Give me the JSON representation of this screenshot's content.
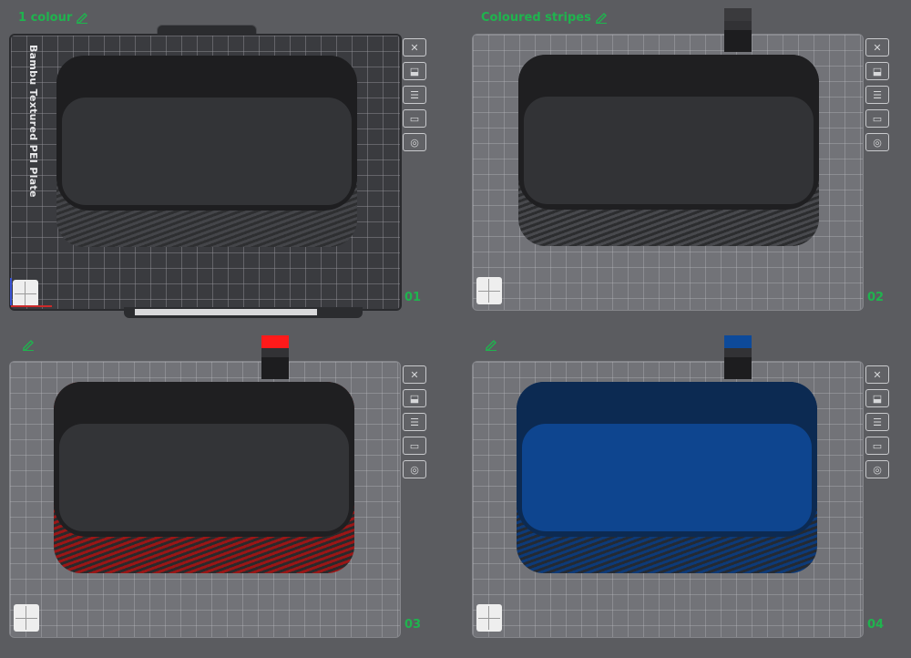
{
  "plates": [
    {
      "title": "1 colour",
      "number": "01",
      "label": "Bambu Textured PEI Plate",
      "style": "dark",
      "tray": {
        "top": "#1e1e20",
        "floor": "#333437",
        "wall_a": "#2e2f31",
        "wall_b": "#444549"
      },
      "tower": null
    },
    {
      "title": "Coloured stripes",
      "number": "02",
      "style": "light",
      "tray": {
        "top": "#1f1f21",
        "floor": "#323336",
        "wall_a": "#2c2d2f",
        "wall_b": "#48494d"
      },
      "tower": {
        "cap": "#3a3a3d"
      }
    },
    {
      "title": "",
      "number": "03",
      "style": "light",
      "tray": {
        "top": "#1f1f21",
        "floor": "#333437",
        "wall_a": "#9a1616",
        "wall_b": "#2a2a2c"
      },
      "tower": {
        "cap": "#ff1a1a"
      }
    },
    {
      "title": "",
      "number": "04",
      "style": "light",
      "tray": {
        "top": "#0c2a52",
        "floor": "#0e458f",
        "wall_a": "#0d3a78",
        "wall_b": "#242a33"
      },
      "tower": {
        "cap": "#0d4a9a"
      }
    }
  ],
  "toolbar_icons": [
    "close-icon",
    "auto-orient-icon",
    "arrange-icon",
    "lock-icon",
    "eye-icon"
  ],
  "colors": {
    "accent": "#1fb44e",
    "background": "#5b5c60"
  }
}
